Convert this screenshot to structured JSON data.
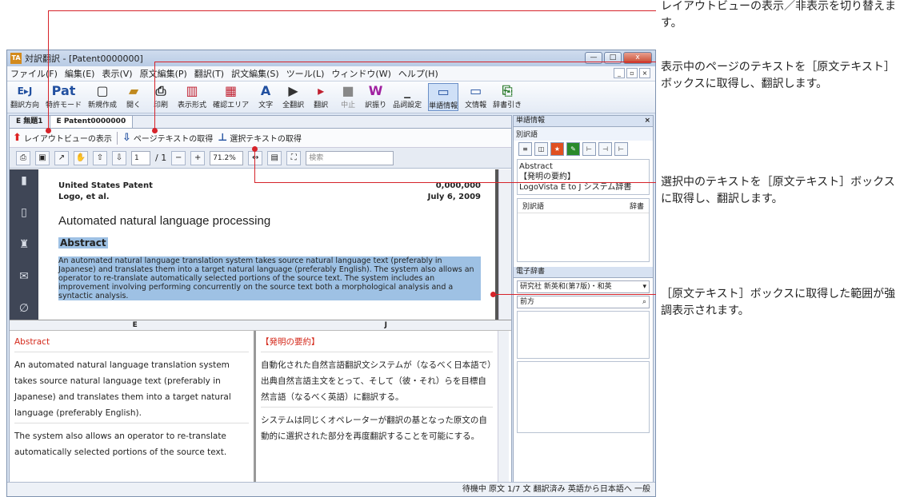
{
  "window": {
    "title": "対訳翻訳 - [Patent0000000]",
    "app_icon": "TA",
    "min": "—",
    "max": "□",
    "close": "x"
  },
  "menu": [
    "ファイル(F)",
    "編集(E)",
    "表示(V)",
    "原文編集(P)",
    "翻訳(T)",
    "訳文編集(S)",
    "ツール(L)",
    "ウィンドウ(W)",
    "ヘルプ(H)"
  ],
  "toolbar": [
    {
      "icon": "E▸J",
      "label": "翻訳方向"
    },
    {
      "icon": "Pat",
      "label": "特許モード"
    },
    {
      "icon": "▢",
      "label": "新規作成"
    },
    {
      "icon": "▰",
      "label": "開く"
    },
    {
      "icon": "⎙",
      "label": "印刷"
    },
    {
      "icon": "▥",
      "label": "表示形式"
    },
    {
      "icon": "▦",
      "label": "確認エリア"
    },
    {
      "icon": "A",
      "label": "文字"
    },
    {
      "icon": "▶",
      "label": "全翻訳"
    },
    {
      "icon": "▸",
      "label": "翻訳"
    },
    {
      "icon": "■",
      "label": "中止"
    },
    {
      "icon": "W",
      "label": "訳振り"
    },
    {
      "icon": "_",
      "label": "品詞設定"
    },
    {
      "icon": "▭",
      "label": "単語情報"
    },
    {
      "icon": "▭",
      "label": "文情報"
    },
    {
      "icon": "⎘",
      "label": "辞書引き"
    }
  ],
  "tabs": [
    "E 無題1",
    "E Patent0000000"
  ],
  "actions": {
    "layout": "レイアウトビューの表示",
    "page_text": "ページテキストの取得",
    "select_text": "選択テキストの取得"
  },
  "viewer": {
    "page_current": "1",
    "page_total": "/ 1",
    "zoom": "71.2%",
    "search_placeholder": "検索"
  },
  "document": {
    "patent_label": "United States Patent",
    "patent_no": "0,000,000",
    "inventor": "Logo, et al.",
    "date": "July 6, 2009",
    "title": "Automated natural language processing",
    "abstract_heading": "Abstract",
    "abstract": "An automated natural language translation system takes source natural language text (preferably in Japanese) and translates them into a target natural language (preferably English). The system also allows an operator to re-translate automatically selected portions of the source text. The system includes an improvement involving performing concurrently on the source text both a morphological analysis and a syntactic analysis."
  },
  "grid": {
    "col_e": "E",
    "col_j": "J",
    "rows": [
      {
        "e": "Abstract",
        "j": "【発明の要約】"
      },
      {
        "e": "An automated natural language translation system takes source natural language text (preferably in Japanese) and translates them into a target natural language (preferably English).",
        "j": "自動化された自然言語翻訳文システムが（なるべく日本語で）出典自然言語主文をとって、そして（彼・それ）らを目標自然言語（なるべく英語）に翻訳する。"
      },
      {
        "e": "The system also allows an operator to re-translate automatically selected portions of the source text.",
        "j": "システムは同じくオペレーターが翻訳の基となった原文の自動的に選択された部分を再度翻訳することを可能にする。"
      }
    ]
  },
  "panel": {
    "title": "単語情報",
    "close": "×",
    "alt_label": "別訳語",
    "entry": "Abstract",
    "entry_jp": "【発明の要約】",
    "dict": "LogoVista E to J システム辞書",
    "alt_col1": "別訳語",
    "alt_col2": "辞書",
    "edict_title": "電子辞書",
    "edict_select": "研究社 新英和(第7版)・和英",
    "match": "前方"
  },
  "status": "待機中 原文 1/7 文 翻訳済み 英語から日本語へ 一般",
  "callouts": {
    "c1": "レイアウトビューの表示／非表示を切り替えます。",
    "c2": "表示中のページのテキストを［原文テキスト］ボックスに取得し、翻訳します。",
    "c3": "選択中のテキストを［原文テキスト］ボックスに取得し、翻訳します。",
    "c4": "［原文テキスト］ボックスに取得した範囲が強調表示されます。"
  },
  "colors": {
    "accent": "#d6232a",
    "highlight": "#9ec1e4"
  }
}
